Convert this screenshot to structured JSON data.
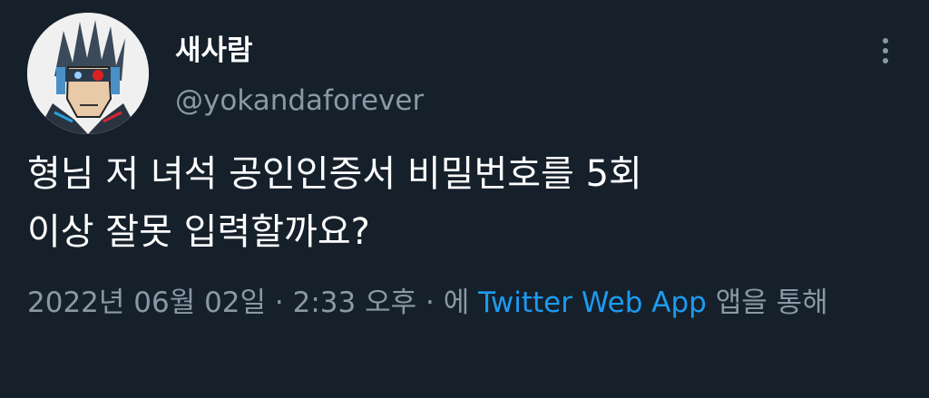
{
  "tweet": {
    "author": {
      "display_name": "새사람",
      "handle": "@yokandaforever",
      "avatar_icon": "robot-avatar"
    },
    "more_icon": "vertical-dots-icon",
    "text_lines": [
      "형님 저 녀석 공인인증서 비밀번호를 5회",
      "이상 잘못 입력할까요?"
    ],
    "meta": {
      "date": "2022년 06월 02일",
      "sep1": " · ",
      "time": "2:33 오후",
      "sep2": " · ",
      "via_prefix": "에 ",
      "source": "Twitter Web App",
      "via_suffix": " 앱을 통해"
    }
  },
  "colors": {
    "background": "#15202b",
    "text": "#ffffff",
    "secondary": "#8b98a5",
    "link": "#1d9bf0"
  }
}
